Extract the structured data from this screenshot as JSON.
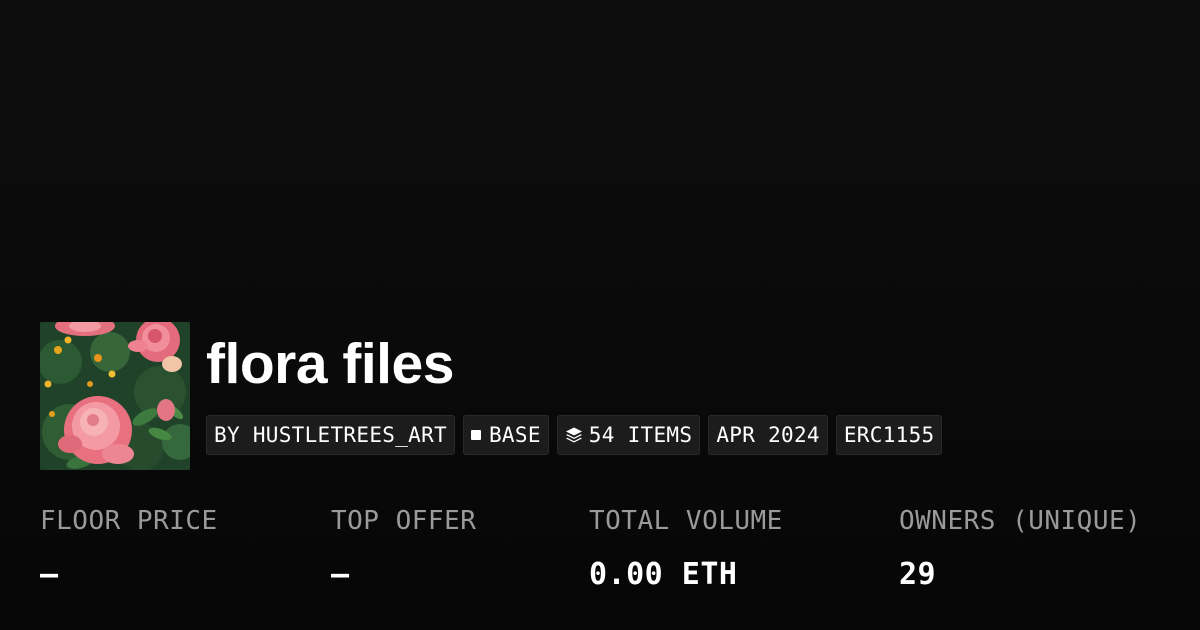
{
  "collection": {
    "name": "flora files",
    "thumbnail_description": "pink-roses-icon"
  },
  "badges": {
    "creator": "BY HUSTLETREES_ART",
    "chain": "BASE",
    "items": "54 ITEMS",
    "date": "APR 2024",
    "standard": "ERC1155"
  },
  "stats": {
    "floor_price": {
      "label": "FLOOR PRICE",
      "value": "—"
    },
    "top_offer": {
      "label": "TOP OFFER",
      "value": "—"
    },
    "total_volume": {
      "label": "TOTAL VOLUME",
      "value": "0.00 ETH"
    },
    "owners": {
      "label": "OWNERS (UNIQUE)",
      "value": "29"
    }
  },
  "colors": {
    "background": "#0a0a0a",
    "badge_background": "#1c1c1c",
    "label": "#9a9a9a",
    "text": "#ffffff"
  }
}
